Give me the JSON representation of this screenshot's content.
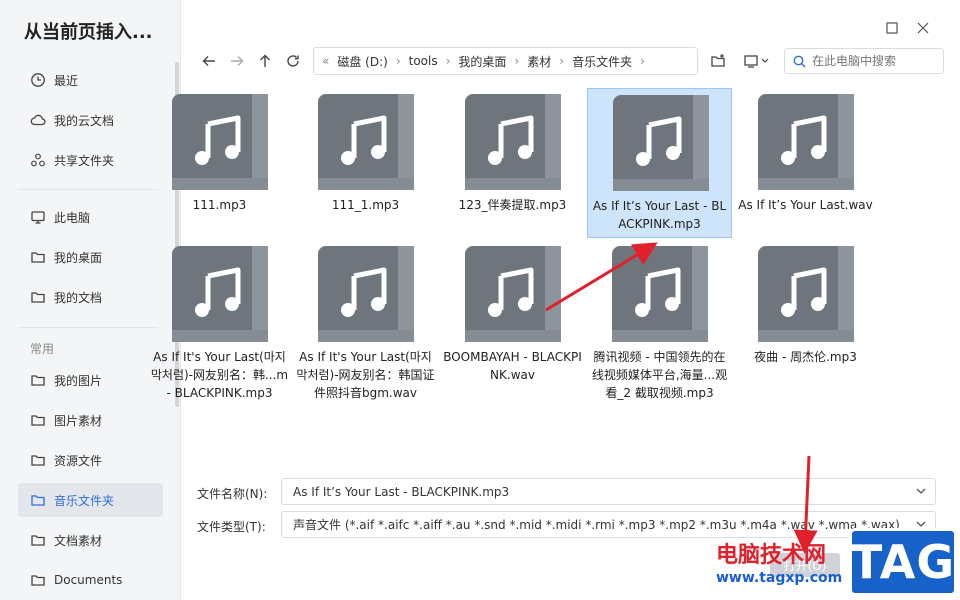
{
  "dialog": {
    "title": "从当前页插入..."
  },
  "sidebar": {
    "items": [
      {
        "label": "最近",
        "icon": "clock-icon"
      },
      {
        "label": "我的云文档",
        "icon": "cloud-icon"
      },
      {
        "label": "共享文件夹",
        "icon": "share-icon"
      },
      {
        "label": "此电脑",
        "icon": "monitor-icon"
      },
      {
        "label": "我的桌面",
        "icon": "folder-icon"
      },
      {
        "label": "我的文档",
        "icon": "folder-icon"
      },
      {
        "label": "我的图片",
        "icon": "folder-icon"
      },
      {
        "label": "图片素材",
        "icon": "folder-icon"
      },
      {
        "label": "资源文件",
        "icon": "folder-icon"
      },
      {
        "label": "音乐文件夹",
        "icon": "folder-icon"
      },
      {
        "label": "文档素材",
        "icon": "folder-icon"
      },
      {
        "label": "Documents",
        "icon": "folder-icon"
      }
    ],
    "section_label": "常用",
    "active": "音乐文件夹"
  },
  "breadcrumb": {
    "items": [
      "磁盘 (D:)",
      "tools",
      "我的桌面",
      "素材",
      "音乐文件夹"
    ]
  },
  "search": {
    "placeholder": "在此电脑中搜索"
  },
  "files": [
    {
      "name": "111.mp3",
      "selected": false
    },
    {
      "name": "111_1.mp3",
      "selected": false
    },
    {
      "name": "123_伴奏提取.mp3",
      "selected": false
    },
    {
      "name": "As If It’s Your Last - BLACKPINK.mp3",
      "selected": true
    },
    {
      "name": "As If It’s Your Last.wav",
      "selected": false
    },
    {
      "name": "As If It's Your Last(마지막처럼)-网友别名：韩...m - BLACKPINK.mp3",
      "selected": false
    },
    {
      "name": "As If It's Your Last(마지막처럼)-网友别名：韩国证件照抖音bgm.wav",
      "selected": false
    },
    {
      "name": "BOOMBAYAH - BLACKPINK.wav",
      "selected": false
    },
    {
      "name": "腾讯视频 - 中国领先的在线视频媒体平台,海量...观看_2 截取视频.mp3",
      "selected": false
    },
    {
      "name": "夜曲 - 周杰伦.mp3",
      "selected": false
    }
  ],
  "form": {
    "filename_label": "文件名称(N):",
    "filename_value": "As If It’s Your Last - BLACKPINK.mp3",
    "filetype_label": "文件类型(T):",
    "filetype_value": "声音文件 (*.aif *.aifc *.aiff *.au *.snd *.mid *.midi *.rmi *.mp3 *.mp2 *.m3u *.m4a *.wav *.wma *.wax)"
  },
  "buttons": {
    "open": "打开(O)"
  },
  "watermark": {
    "text": "电脑技术网",
    "url": "www.tagxp.com",
    "logo": "TAG"
  },
  "colors": {
    "accent": "#2f6fd6",
    "selected_bg": "#cde4fb",
    "arrow": "#e0202a",
    "icon": "#6e757c"
  }
}
